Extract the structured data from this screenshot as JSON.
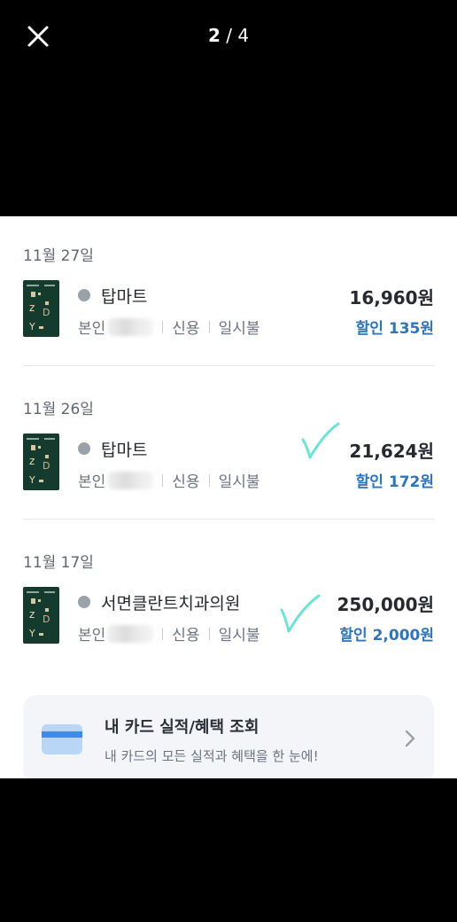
{
  "viewer": {
    "current": "2",
    "separator": "/",
    "total": "4",
    "close_icon": "close-icon"
  },
  "transactions": [
    {
      "date": "11월 27일",
      "merchant": "탑마트",
      "amount": "16,960원",
      "owner": "본인",
      "type": "신용",
      "plan": "일시불",
      "discount": "할인 135원",
      "checked": false
    },
    {
      "date": "11월 26일",
      "merchant": "탑마트",
      "amount": "21,624원",
      "owner": "본인",
      "type": "신용",
      "plan": "일시불",
      "discount": "할인 172원",
      "checked": true
    },
    {
      "date": "11월 17일",
      "merchant": "서면클란트치과의원",
      "amount": "250,000원",
      "owner": "본인",
      "type": "신용",
      "plan": "일시불",
      "discount": "할인 2,000원",
      "checked": true
    }
  ],
  "banner": {
    "title": "내 카드 실적/혜택 조회",
    "subtitle": "내 카드의 모든 실적과 혜택을 한 눈에!",
    "icon": "credit-card-icon",
    "chevron": "chevron-right-icon"
  },
  "colors": {
    "discount": "#2f74b5",
    "check_mark": "#6fe3d3",
    "card_green": "#153a2e",
    "banner_bg": "#f3f5f8"
  }
}
